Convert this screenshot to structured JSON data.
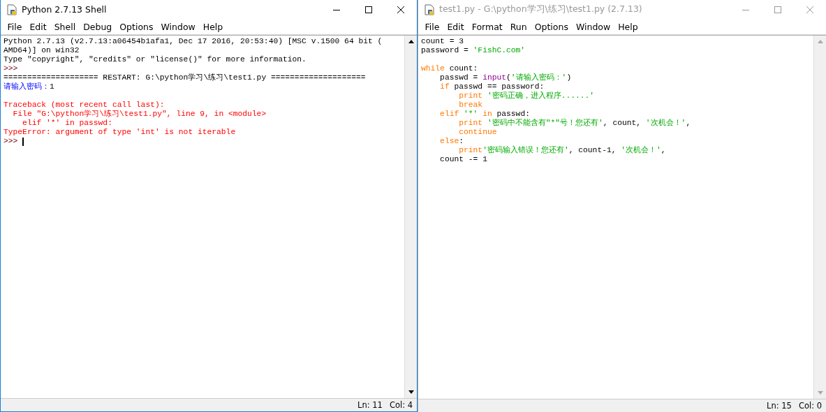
{
  "windows": [
    {
      "title": "Python 2.7.13 Shell",
      "active": true,
      "menu": [
        {
          "label": "File"
        },
        {
          "label": "Edit"
        },
        {
          "label": "Shell"
        },
        {
          "label": "Debug"
        },
        {
          "label": "Options"
        },
        {
          "label": "Window"
        },
        {
          "label": "Help"
        }
      ],
      "lines": [
        {
          "kind": "text",
          "tokens": [
            {
              "kind": "plain",
              "text": "Python 2.7.13 (v2.7.13:a06454b1afa1, Dec 17 2016, 20:53:40) [MSC v.1500 64 bit ("
            }
          ]
        },
        {
          "kind": "text",
          "tokens": [
            {
              "kind": "plain",
              "text": "AMD64)] on win32"
            }
          ]
        },
        {
          "kind": "text",
          "tokens": [
            {
              "kind": "plain",
              "text": "Type \"copyright\", \"credits\" or \"license()\" for more information."
            }
          ]
        },
        {
          "kind": "text",
          "tokens": [
            {
              "kind": "prompt",
              "text": ">>>"
            }
          ]
        },
        {
          "kind": "text",
          "tokens": [
            {
              "kind": "plain",
              "text": "==================== RESTART: G:\\python学习\\练习\\test1.py ===================="
            }
          ]
        },
        {
          "kind": "text",
          "tokens": [
            {
              "kind": "stdout",
              "text": "请输入密码："
            },
            {
              "kind": "plain",
              "text": "1"
            }
          ]
        },
        {
          "kind": "blank"
        },
        {
          "kind": "text",
          "tokens": [
            {
              "kind": "error",
              "text": "Traceback (most recent call last):"
            }
          ]
        },
        {
          "kind": "text",
          "tokens": [
            {
              "kind": "error",
              "text": "  File \"G:\\python学习\\练习\\test1.py\", line 9, in <module>"
            }
          ]
        },
        {
          "kind": "text",
          "tokens": [
            {
              "kind": "error",
              "text": "    elif '*' in passwd:"
            }
          ]
        },
        {
          "kind": "text",
          "tokens": [
            {
              "kind": "error",
              "text": "TypeError: argument of type 'int' is not iterable"
            }
          ]
        },
        {
          "kind": "text",
          "cursor": true,
          "tokens": [
            {
              "kind": "prompt",
              "text": ">>>"
            }
          ]
        }
      ],
      "status": {
        "line": "Ln: 11",
        "col": "Col: 4"
      }
    },
    {
      "title": "test1.py - G:\\python学习\\练习\\test1.py (2.7.13)",
      "active": false,
      "menu": [
        {
          "label": "File"
        },
        {
          "label": "Edit"
        },
        {
          "label": "Format"
        },
        {
          "label": "Run"
        },
        {
          "label": "Options"
        },
        {
          "label": "Window"
        },
        {
          "label": "Help"
        }
      ],
      "lines": [
        {
          "kind": "text",
          "tokens": [
            {
              "kind": "plain",
              "text": "count = 3"
            }
          ]
        },
        {
          "kind": "text",
          "tokens": [
            {
              "kind": "plain",
              "text": "password = "
            },
            {
              "kind": "string",
              "text": "'FishC.com'"
            }
          ]
        },
        {
          "kind": "blank"
        },
        {
          "kind": "text",
          "tokens": [
            {
              "kind": "keyword",
              "text": "while"
            },
            {
              "kind": "plain",
              "text": " count:"
            }
          ]
        },
        {
          "kind": "text",
          "tokens": [
            {
              "kind": "plain",
              "text": "    passwd = "
            },
            {
              "kind": "builtin",
              "text": "input"
            },
            {
              "kind": "plain",
              "text": "("
            },
            {
              "kind": "string",
              "text": "'请输入密码：'"
            },
            {
              "kind": "plain",
              "text": ")"
            }
          ]
        },
        {
          "kind": "text",
          "tokens": [
            {
              "kind": "keyword",
              "text": "    if"
            },
            {
              "kind": "plain",
              "text": " passwd == password:"
            }
          ]
        },
        {
          "kind": "text",
          "tokens": [
            {
              "kind": "keyword",
              "text": "        print"
            },
            {
              "kind": "string",
              "text": " '密码正确，进入程序......'"
            }
          ]
        },
        {
          "kind": "text",
          "tokens": [
            {
              "kind": "keyword",
              "text": "        break"
            }
          ]
        },
        {
          "kind": "text",
          "tokens": [
            {
              "kind": "keyword",
              "text": "    elif"
            },
            {
              "kind": "string",
              "text": " '*'"
            },
            {
              "kind": "keyword",
              "text": " in"
            },
            {
              "kind": "plain",
              "text": " passwd:"
            }
          ]
        },
        {
          "kind": "text",
          "tokens": [
            {
              "kind": "keyword",
              "text": "        print"
            },
            {
              "kind": "string",
              "text": " '密码中不能含有\"*\"号！您还有'"
            },
            {
              "kind": "plain",
              "text": ", count, "
            },
            {
              "kind": "string",
              "text": "'次机会！'"
            },
            {
              "kind": "plain",
              "text": ","
            }
          ]
        },
        {
          "kind": "text",
          "tokens": [
            {
              "kind": "keyword",
              "text": "        continue"
            }
          ]
        },
        {
          "kind": "text",
          "tokens": [
            {
              "kind": "keyword",
              "text": "    else"
            },
            {
              "kind": "plain",
              "text": ":"
            }
          ]
        },
        {
          "kind": "text",
          "tokens": [
            {
              "kind": "keyword",
              "text": "        print"
            },
            {
              "kind": "string",
              "text": "'密码输入错误！您还有'"
            },
            {
              "kind": "plain",
              "text": ", count-1, "
            },
            {
              "kind": "string",
              "text": "'次机会！'"
            },
            {
              "kind": "plain",
              "text": ","
            }
          ]
        },
        {
          "kind": "text",
          "tokens": [
            {
              "kind": "plain",
              "text": "    count -= 1"
            }
          ]
        }
      ],
      "status": {
        "line": "Ln: 15",
        "col": "Col: 0"
      }
    }
  ]
}
